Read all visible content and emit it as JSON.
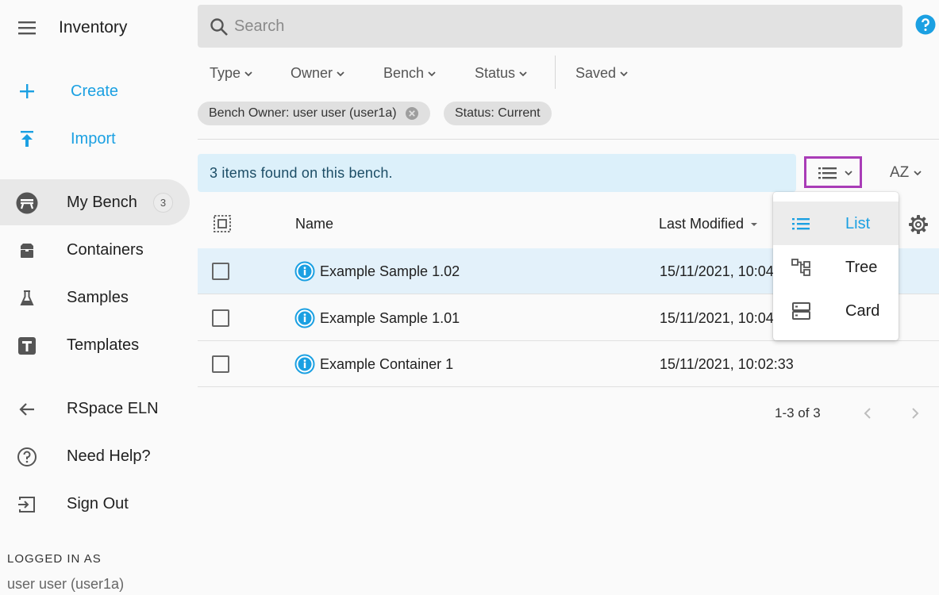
{
  "colors": {
    "accent": "#1ba0e2",
    "highlight_box": "#a93cb7",
    "info_bg": "#dcf0fa",
    "selected_row": "#e3f1fa"
  },
  "header": {
    "menu_icon": "hamburger-menu-icon",
    "app_title": "Inventory"
  },
  "sidebar": {
    "actions": [
      {
        "label": "Create",
        "icon": "plus-icon"
      },
      {
        "label": "Import",
        "icon": "upload-icon"
      }
    ],
    "nav": [
      {
        "label": "My Bench",
        "icon": "bench-icon",
        "badge": "3",
        "active": true
      },
      {
        "label": "Containers",
        "icon": "box-icon"
      },
      {
        "label": "Samples",
        "icon": "flask-icon"
      },
      {
        "label": "Templates",
        "icon": "template-icon"
      }
    ],
    "links": [
      {
        "label": "RSpace ELN",
        "icon": "arrow-left-icon"
      },
      {
        "label": "Need Help?",
        "icon": "help-circle-icon"
      },
      {
        "label": "Sign Out",
        "icon": "sign-out-icon"
      }
    ],
    "logged_in_label": "LOGGED IN AS",
    "logged_in_user": "user user (user1a)"
  },
  "search": {
    "placeholder": "Search",
    "value": ""
  },
  "filters": [
    "Type",
    "Owner",
    "Bench",
    "Status",
    "Saved"
  ],
  "chips": [
    {
      "label": "Bench Owner: user user (user1a)",
      "removable": true
    },
    {
      "label": "Status: Current",
      "removable": false
    }
  ],
  "results_info": "3 items found on this bench.",
  "view_toggle_icon": "list-view-icon",
  "sort_label": "AZ",
  "table": {
    "columns": [
      "Name",
      "Last Modified"
    ],
    "rows": [
      {
        "name": "Example Sample 1.02",
        "modified": "15/11/2021, 10:04",
        "selected": true
      },
      {
        "name": "Example Sample 1.01",
        "modified": "15/11/2021, 10:04",
        "selected": false
      },
      {
        "name": "Example Container 1",
        "modified": "15/11/2021, 10:02:33",
        "selected": false
      }
    ]
  },
  "pagination": {
    "text": "1-3 of 3"
  },
  "view_menu": {
    "items": [
      {
        "label": "List",
        "icon": "list-icon",
        "active": true
      },
      {
        "label": "Tree",
        "icon": "tree-icon"
      },
      {
        "label": "Card",
        "icon": "card-icon"
      }
    ]
  }
}
